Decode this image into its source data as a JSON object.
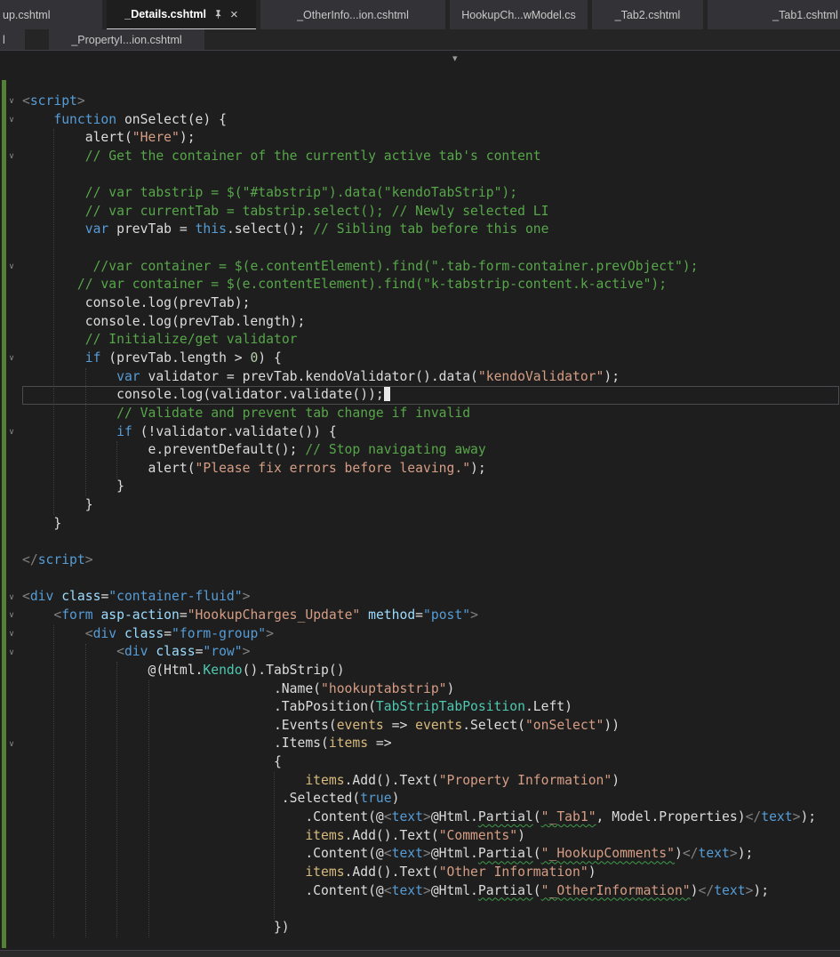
{
  "colors": {
    "editor_bg": "#1e1e1e",
    "tab_bar_bg": "#252526",
    "tab_inactive_bg": "#333337",
    "tab_active_bg": "#1e1e1e",
    "tab_text": "#c8c8c8",
    "tab_active_text": "#ffffff",
    "keyword": "#569cd6",
    "comment": "#57a64a",
    "string": "#d69d85",
    "attr_name": "#9cdcfe",
    "attr_value": "#569cd6",
    "type": "#4ec9b0",
    "parameter": "#d7ba7d",
    "number": "#b5cea8",
    "plain_text": "#dcdcdc",
    "tag_delimiter": "#808080",
    "change_tracking_bar": "#538135",
    "squiggle": "#3f9b4a",
    "current_line_border": "#4a4a4f"
  },
  "icons": {
    "close": "×",
    "chevron_down": "▾",
    "fold": "∨",
    "pin": "pushpin"
  },
  "tab_rows": [
    {
      "tabs": [
        {
          "label": "up.cshtml",
          "state": "inactive",
          "clipped": "left"
        },
        {
          "label": "_Details.cshtml",
          "state": "active",
          "pinned": true,
          "closable": true
        },
        {
          "label": "_OtherInfo...ion.cshtml",
          "state": "inactive"
        },
        {
          "label": "HookupCh...wModel.cs",
          "state": "inactive"
        },
        {
          "label": "_Tab2.cshtml",
          "state": "inactive"
        },
        {
          "label": "_Tab1.cshtml",
          "state": "inactive",
          "clipped": "right"
        }
      ]
    },
    {
      "tabs": [
        {
          "label": "l",
          "state": "inactive",
          "clipped": "left"
        },
        {
          "label": "_PropertyI...ion.cshtml",
          "state": "inactive"
        }
      ]
    }
  ],
  "editor": {
    "caret_line": 17,
    "lines": [
      [
        [
          "g",
          "<"
        ],
        [
          "k",
          "script"
        ],
        [
          "g",
          ">"
        ]
      ],
      [
        [
          "p",
          "    "
        ],
        [
          "k",
          "function"
        ],
        [
          "p",
          " onSelect(e) {"
        ]
      ],
      [
        [
          "p",
          "        alert("
        ],
        [
          "s",
          "\"Here\""
        ],
        [
          "p",
          ");"
        ]
      ],
      [
        [
          "p",
          "        "
        ],
        [
          "c",
          "// Get the container of the currently active tab's content"
        ]
      ],
      [],
      [
        [
          "p",
          "        "
        ],
        [
          "c",
          "// var tabstrip = $(\"#tabstrip\").data(\"kendoTabStrip\");"
        ]
      ],
      [
        [
          "p",
          "        "
        ],
        [
          "c",
          "// var currentTab = tabstrip.select(); // Newly selected LI"
        ]
      ],
      [
        [
          "p",
          "        "
        ],
        [
          "k",
          "var"
        ],
        [
          "p",
          " prevTab = "
        ],
        [
          "k",
          "this"
        ],
        [
          "p",
          ".select(); "
        ],
        [
          "c",
          "// Sibling tab before this one"
        ]
      ],
      [],
      [
        [
          "p",
          "         "
        ],
        [
          "c",
          "//var container = $(e.contentElement).find(\".tab-form-container.prevObject\");"
        ]
      ],
      [
        [
          "p",
          "       "
        ],
        [
          "c",
          "// var container = $(e.contentElement).find(\"k-tabstrip-content.k-active\");"
        ]
      ],
      [
        [
          "p",
          "        console.log(prevTab);"
        ]
      ],
      [
        [
          "p",
          "        console.log(prevTab.length);"
        ]
      ],
      [
        [
          "p",
          "        "
        ],
        [
          "c",
          "// Initialize/get validator"
        ]
      ],
      [
        [
          "p",
          "        "
        ],
        [
          "k",
          "if"
        ],
        [
          "p",
          " (prevTab.length > "
        ],
        [
          "n",
          "0"
        ],
        [
          "p",
          ") {"
        ]
      ],
      [
        [
          "p",
          "            "
        ],
        [
          "k",
          "var"
        ],
        [
          "p",
          " validator = prevTab.kendoValidator().data("
        ],
        [
          "s",
          "\"kendoValidator\""
        ],
        [
          "p",
          ");"
        ]
      ],
      [
        [
          "p",
          "            console.log(validator.validate());"
        ]
      ],
      [
        [
          "p",
          "            "
        ],
        [
          "c",
          "// Validate and prevent tab change if invalid"
        ]
      ],
      [
        [
          "p",
          "            "
        ],
        [
          "k",
          "if"
        ],
        [
          "p",
          " (!validator.validate()) {"
        ]
      ],
      [
        [
          "p",
          "                e.preventDefault(); "
        ],
        [
          "c",
          "// Stop navigating away"
        ]
      ],
      [
        [
          "p",
          "                alert("
        ],
        [
          "s",
          "\"Please fix errors before leaving.\""
        ],
        [
          "p",
          ");"
        ]
      ],
      [
        [
          "p",
          "            }"
        ]
      ],
      [
        [
          "p",
          "        }"
        ]
      ],
      [
        [
          "p",
          "    }"
        ]
      ],
      [],
      [
        [
          "g",
          "</"
        ],
        [
          "k",
          "script"
        ],
        [
          "g",
          ">"
        ]
      ],
      [],
      [
        [
          "g",
          "<"
        ],
        [
          "k",
          "div"
        ],
        [
          "p",
          " "
        ],
        [
          "a",
          "class"
        ],
        [
          "p",
          "="
        ],
        [
          "v",
          "\"container-fluid\""
        ],
        [
          "g",
          ">"
        ]
      ],
      [
        [
          "p",
          "    "
        ],
        [
          "g",
          "<"
        ],
        [
          "k",
          "form"
        ],
        [
          "p",
          " "
        ],
        [
          "a",
          "asp-action"
        ],
        [
          "p",
          "="
        ],
        [
          "s",
          "\"HookupCharges_Update\""
        ],
        [
          "p",
          " "
        ],
        [
          "a",
          "method"
        ],
        [
          "p",
          "="
        ],
        [
          "v",
          "\"post\""
        ],
        [
          "g",
          ">"
        ]
      ],
      [
        [
          "p",
          "        "
        ],
        [
          "g",
          "<"
        ],
        [
          "k",
          "div"
        ],
        [
          "p",
          " "
        ],
        [
          "a",
          "class"
        ],
        [
          "p",
          "="
        ],
        [
          "v",
          "\"form-group\""
        ],
        [
          "g",
          ">"
        ]
      ],
      [
        [
          "p",
          "            "
        ],
        [
          "g",
          "<"
        ],
        [
          "k",
          "div"
        ],
        [
          "p",
          " "
        ],
        [
          "a",
          "class"
        ],
        [
          "p",
          "="
        ],
        [
          "v",
          "\"row\""
        ],
        [
          "g",
          ">"
        ]
      ],
      [
        [
          "p",
          "                @(Html."
        ],
        [
          "ty",
          "Kendo"
        ],
        [
          "p",
          "().TabStrip()"
        ]
      ],
      [
        [
          "p",
          "                                .Name("
        ],
        [
          "s",
          "\"hookuptabstrip\""
        ],
        [
          "p",
          ")"
        ]
      ],
      [
        [
          "p",
          "                                .TabPosition("
        ],
        [
          "ty",
          "TabStripTabPosition"
        ],
        [
          "p",
          ".Left)"
        ]
      ],
      [
        [
          "p",
          "                                .Events("
        ],
        [
          "pa",
          "events"
        ],
        [
          "p",
          " => "
        ],
        [
          "pa",
          "events"
        ],
        [
          "p",
          ".Select("
        ],
        [
          "s",
          "\"onSelect\""
        ],
        [
          "p",
          "))"
        ]
      ],
      [
        [
          "p",
          "                                .Items("
        ],
        [
          "pa",
          "items"
        ],
        [
          "p",
          " =>"
        ]
      ],
      [
        [
          "p",
          "                                {"
        ]
      ],
      [
        [
          "p",
          "                                    "
        ],
        [
          "pa",
          "items"
        ],
        [
          "p",
          ".Add().Text("
        ],
        [
          "s",
          "\"Property Information\""
        ],
        [
          "p",
          ")"
        ]
      ],
      [
        [
          "p",
          "                                 .Selected("
        ],
        [
          "k",
          "true"
        ],
        [
          "p",
          ")"
        ]
      ],
      [
        [
          "p",
          "                                    .Content(@"
        ],
        [
          "g",
          "<"
        ],
        [
          "k",
          "text"
        ],
        [
          "g",
          ">"
        ],
        [
          "p",
          "@Html."
        ],
        [
          "p sq",
          "Partial"
        ],
        [
          "p",
          "("
        ],
        [
          "s sq",
          "\"_Tab1\""
        ],
        [
          "p",
          ", Model.Properties)"
        ],
        [
          "g",
          "</"
        ],
        [
          "k",
          "text"
        ],
        [
          "g",
          ">"
        ],
        [
          "p",
          ");"
        ]
      ],
      [
        [
          "p",
          "                                    "
        ],
        [
          "pa",
          "items"
        ],
        [
          "p",
          ".Add().Text("
        ],
        [
          "s",
          "\"Comments\""
        ],
        [
          "p",
          ")"
        ]
      ],
      [
        [
          "p",
          "                                    .Content(@"
        ],
        [
          "g",
          "<"
        ],
        [
          "k",
          "text"
        ],
        [
          "g",
          ">"
        ],
        [
          "p",
          "@Html."
        ],
        [
          "p sq",
          "Partial"
        ],
        [
          "p",
          "("
        ],
        [
          "s sq",
          "\"_HookupComments\""
        ],
        [
          "p",
          ")"
        ],
        [
          "g",
          "</"
        ],
        [
          "k",
          "text"
        ],
        [
          "g",
          ">"
        ],
        [
          "p",
          ");"
        ]
      ],
      [
        [
          "p",
          "                                    "
        ],
        [
          "pa",
          "items"
        ],
        [
          "p",
          ".Add().Text("
        ],
        [
          "s",
          "\"Other Information\""
        ],
        [
          "p",
          ")"
        ]
      ],
      [
        [
          "p",
          "                                    .Content(@"
        ],
        [
          "g",
          "<"
        ],
        [
          "k",
          "text"
        ],
        [
          "g",
          ">"
        ],
        [
          "p",
          "@Html."
        ],
        [
          "p sq",
          "Partial"
        ],
        [
          "p",
          "("
        ],
        [
          "s sq",
          "\"_OtherInformation\""
        ],
        [
          "p",
          ")"
        ],
        [
          "g",
          "</"
        ],
        [
          "k",
          "text"
        ],
        [
          "g",
          ">"
        ],
        [
          "p",
          ");"
        ]
      ],
      [],
      [
        [
          "p",
          "                                })"
        ]
      ]
    ]
  }
}
